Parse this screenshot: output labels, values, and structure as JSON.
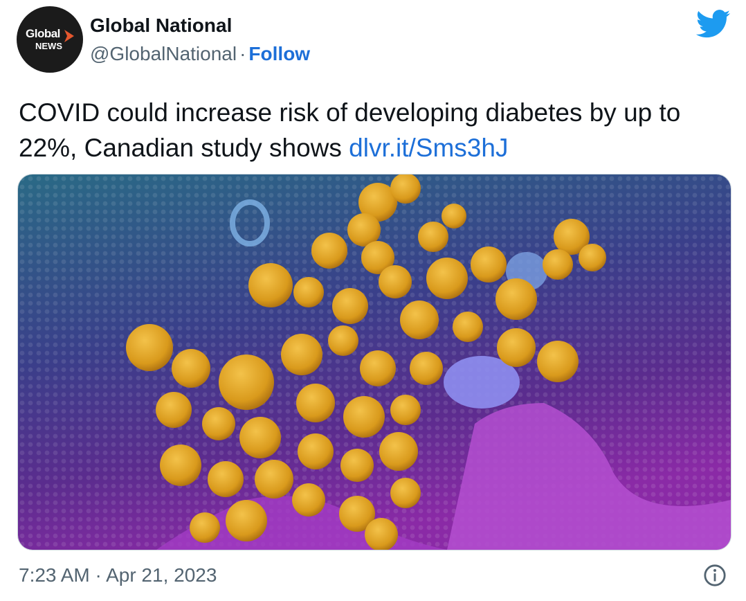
{
  "account": {
    "display_name": "Global National",
    "handle": "@GlobalNational",
    "separator": "·",
    "follow_label": "Follow",
    "avatar": {
      "logo_word": "Global",
      "logo_sub": "NEWS",
      "icon": "global-news-logo"
    }
  },
  "header": {
    "platform_icon": "twitter-bird-icon",
    "brand_color": "#1d9bf0"
  },
  "tweet": {
    "text": "COVID could increase risk of developing diabetes by up to 22%, Canadian study shows ",
    "link_text": "dlvr.it/Sms3hJ"
  },
  "media": {
    "description_icon": "virus-micrograph-image"
  },
  "footer": {
    "timestamp": "7:23 AM · Apr 21, 2023",
    "info_icon": "info-icon"
  },
  "colors": {
    "link": "#1d6fd8",
    "secondary_text": "#536471",
    "primary_text": "#0f1419"
  }
}
